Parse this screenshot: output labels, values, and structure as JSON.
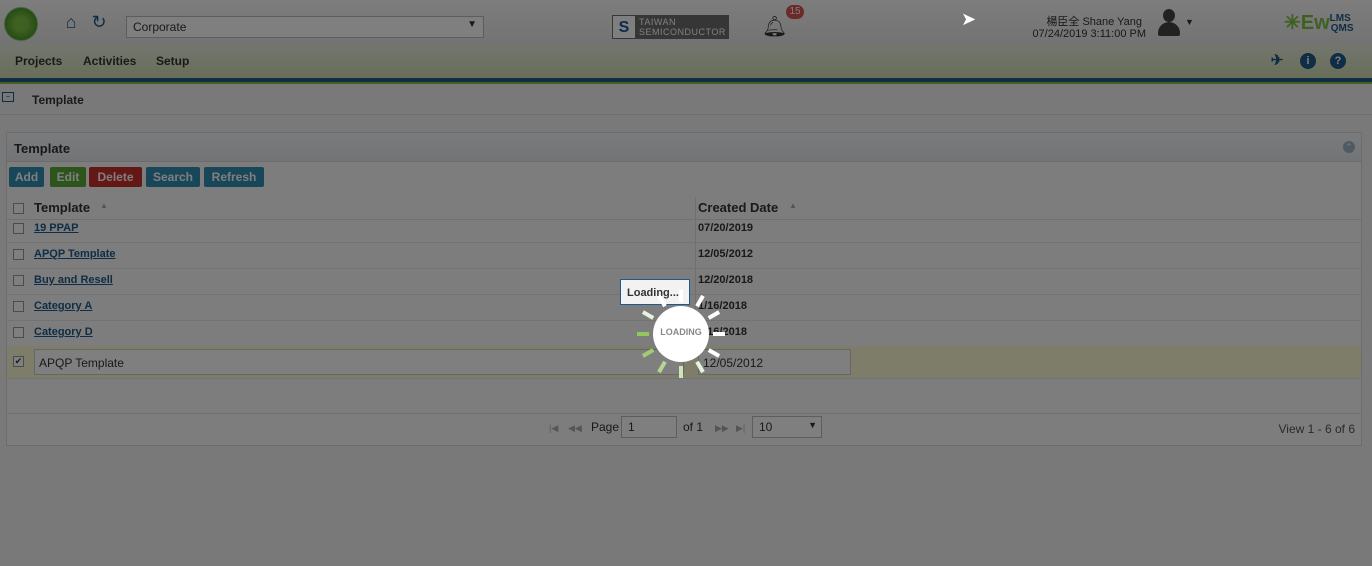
{
  "header": {
    "org_select": "Corporate",
    "company_logo": {
      "mark": "S",
      "line1": "TAIWAN",
      "line2": "SEMICONDUCTOR"
    },
    "notification_count": "15",
    "user_name": "楊臣全 Shane Yang",
    "datetime": "07/24/2019 3:11:00 PM",
    "brand": {
      "main": "Ew",
      "sup": "LMS",
      "sub": "QMS"
    }
  },
  "menu": {
    "items": [
      "Projects",
      "Activities",
      "Setup"
    ]
  },
  "breadcrumb": {
    "title": "Template"
  },
  "panel": {
    "title": "Template",
    "toolbar": {
      "add": "Add",
      "edit": "Edit",
      "delete": "Delete",
      "search": "Search",
      "refresh": "Refresh"
    },
    "columns": [
      "Template",
      "Created Date"
    ],
    "rows": [
      {
        "name": "19 PPAP",
        "date": "07/20/2019"
      },
      {
        "name": "APQP Template",
        "date": "12/05/2012"
      },
      {
        "name": "Buy and Resell",
        "date": "12/20/2018"
      },
      {
        "name": "Category A",
        "date": "1/16/2018"
      },
      {
        "name": "Category D",
        "date": "1/16/2018"
      }
    ],
    "edit_row": {
      "name": "APQP Template",
      "date": "12/05/2012"
    },
    "pager": {
      "page_label": "Page",
      "page_value": "1",
      "of_label": "of 1",
      "rows_per_page": "10",
      "view_info": "View 1 - 6 of 6"
    }
  },
  "loading": {
    "box_text": "Loading...",
    "spinner_text": "LOADING"
  },
  "colors": {
    "primary": "#1f5a8a",
    "accent_green": "#7cc242",
    "btn_add": "#2f8fb0",
    "btn_edit": "#5aa836",
    "btn_delete": "#c9302c",
    "btn_search": "#2f8fb0",
    "btn_refresh": "#2f8fb0"
  }
}
